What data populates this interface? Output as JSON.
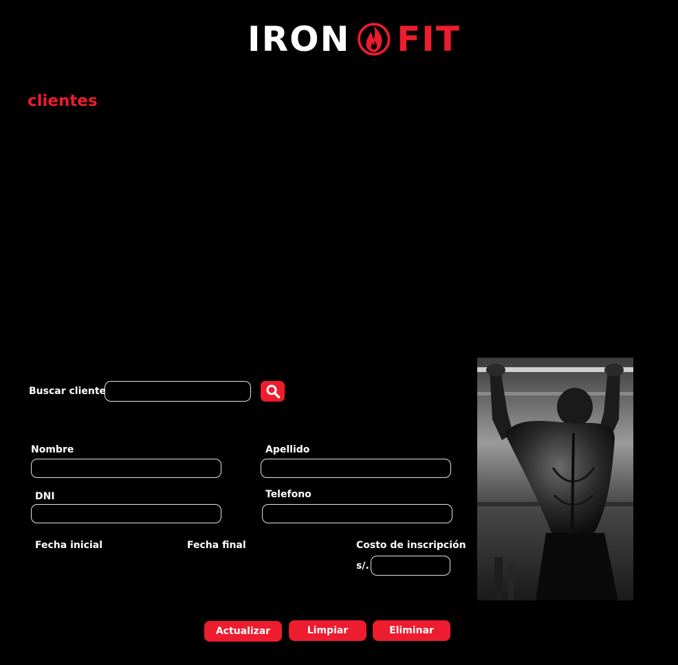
{
  "brand": {
    "name_left": "IRON",
    "name_right": "FIT",
    "icon": "flame-icon",
    "accent_color": "#ed1c2e"
  },
  "page": {
    "section_title": "clientes"
  },
  "search": {
    "label": "Buscar cliente",
    "value": "",
    "button_icon": "search-icon"
  },
  "form": {
    "nombre": {
      "label": "Nombre",
      "value": ""
    },
    "apellido": {
      "label": "Apellido",
      "value": ""
    },
    "dni": {
      "label": "DNI",
      "value": ""
    },
    "telefono": {
      "label": "Telefono",
      "value": ""
    },
    "fecha_inicial": {
      "label": "Fecha inicial"
    },
    "fecha_final": {
      "label": "Fecha final"
    },
    "costo": {
      "label": "Costo de inscripción",
      "currency_prefix": "s/.",
      "value": ""
    }
  },
  "actions": {
    "update_label": "Actualizar",
    "clear_label": "Limpiar",
    "delete_label": "Eliminar"
  }
}
